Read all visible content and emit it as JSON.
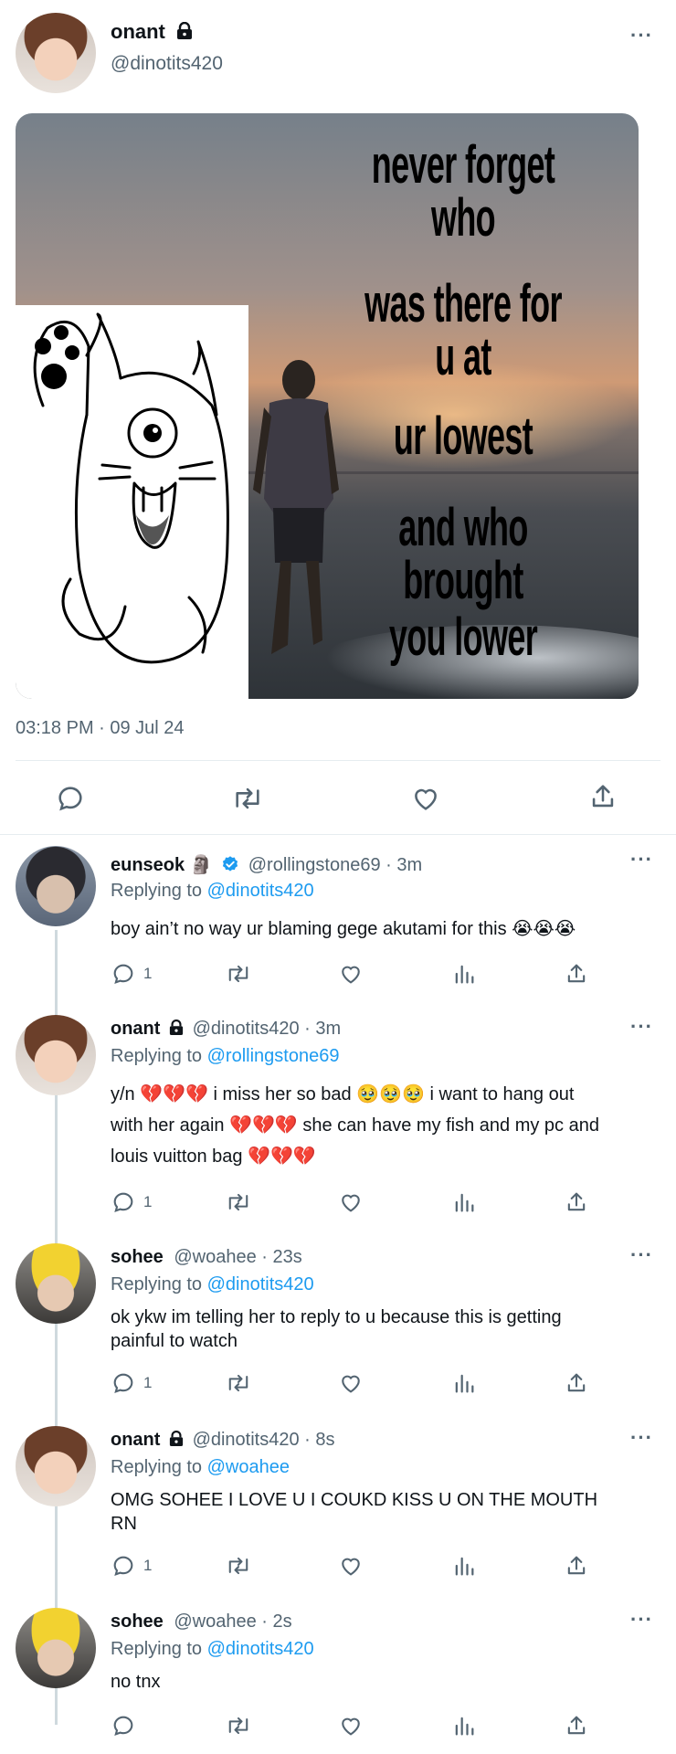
{
  "main_tweet": {
    "display_name": "onant",
    "handle": "@dinotits420",
    "timestamp": "03:18 PM · 09 Jul 24",
    "meme_lines": [
      "never forget who",
      "was there for u at",
      "ur lowest",
      "and who brought",
      "you lower"
    ]
  },
  "replies": [
    {
      "display_name": "eunseok 🗿",
      "verified": true,
      "meta": "@rollingstone69 · 3m",
      "replying_label": "Replying to",
      "replying_to": "@dinotits420",
      "text_lines": [
        "boy ain’t no way ur blaming gege akutami for this 😭😭😭"
      ],
      "reply_count": "1"
    },
    {
      "display_name": "onant",
      "locked": true,
      "meta": "@dinotits420 · 3m",
      "replying_label": "Replying to",
      "replying_to": "@rollingstone69",
      "text_lines": [
        "y/n 💔💔💔 i miss her so bad 🥹🥹🥹  i want to hang out",
        "with her again 💔💔💔  she can have my fish and my pc and",
        "louis vuitton bag 💔💔💔"
      ],
      "reply_count": "1"
    },
    {
      "display_name": "sohee",
      "meta": "@woahee · 23s",
      "replying_label": "Replying to",
      "replying_to": "@dinotits420",
      "text_lines": [
        "ok ykw im telling her to reply to u because this is getting",
        "painful to watch"
      ],
      "reply_count": "1"
    },
    {
      "display_name": "onant",
      "locked": true,
      "meta": "@dinotits420 · 8s",
      "replying_label": "Replying to",
      "replying_to": "@woahee",
      "text_lines": [
        "OMG SOHEE I LOVE U I COUKD KISS U ON THE MOUTH",
        "RN"
      ],
      "reply_count": "1"
    },
    {
      "display_name": "sohee",
      "meta": "@woahee · 2s",
      "replying_label": "Replying to",
      "replying_to": "@dinotits420",
      "text_lines": [
        "no tnx"
      ],
      "reply_count": ""
    }
  ],
  "icons": [
    "reply-icon",
    "retweet-icon",
    "like-icon",
    "share-icon",
    "views-icon",
    "more-icon",
    "lock-icon",
    "verified-icon"
  ],
  "colors": {
    "link": "#1d9bf0",
    "secondary_text": "#536471",
    "divider": "#e6ecf0"
  }
}
